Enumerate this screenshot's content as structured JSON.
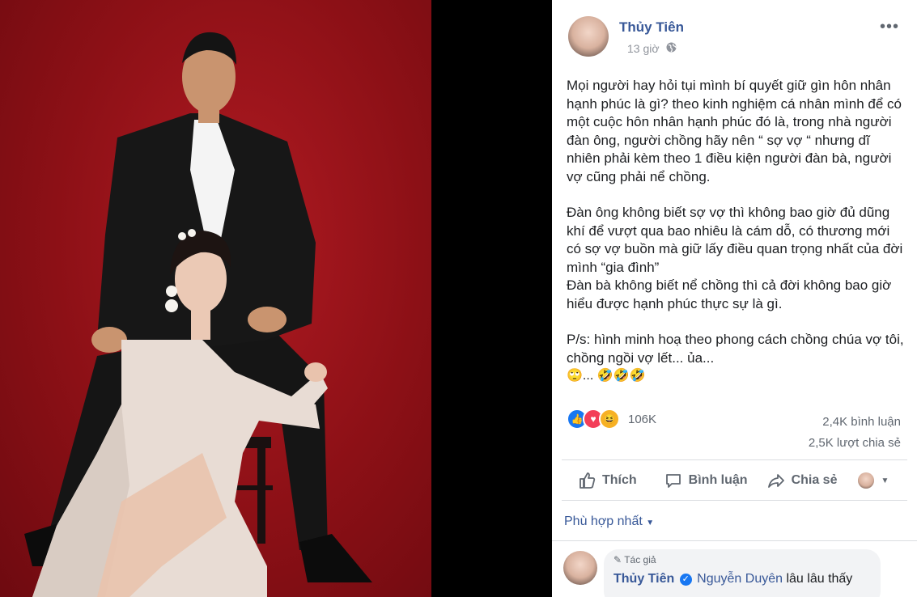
{
  "post": {
    "author": "Thủy Tiên",
    "time": "13 giờ",
    "more_label": "•••",
    "paragraphs": [
      "Mọi người hay hỏi tụi mình bí quyết giữ gìn hôn nhân hạnh phúc là gì? theo kinh nghiệm cá nhân mình để có một cuộc hôn nhân hạnh phúc đó là, trong nhà người đàn ông, người chồng hãy nên “ sợ vợ “ nhưng dĩ nhiên phải kèm theo 1 điều kiện người đàn bà, người vợ cũng phải nể chồng.",
      "Đàn ông không biết sợ vợ thì không bao giờ đủ dũng khí để vượt qua bao nhiêu là cám dỗ, có thương mới có sợ vợ buồn mà giữ lấy điều quan trọng nhất của đời mình “gia đình”",
      "Đàn bà không biết nể chồng thì cả đời không bao giờ hiểu được hạnh phúc thực sự là gì.",
      "P/s: hình minh hoạ theo phong cách chồng chúa vợ tôi, chồng ngồi vợ lết... ủa...",
      "🙄... 🤣🤣🤣"
    ],
    "reactions": {
      "icons": [
        "like-icon",
        "love-icon",
        "haha-icon"
      ],
      "count": "106K",
      "comments": "2,4K bình luận",
      "shares": "2,5K lượt chia sẻ"
    },
    "actions": {
      "like": "Thích",
      "comment": "Bình luận",
      "share": "Chia sẻ"
    },
    "sort_label": "Phù hợp nhất"
  },
  "comment": {
    "badge": "Tác giả",
    "author": "Thủy Tiên",
    "tag": "Nguyễn Duyên",
    "text": "lâu lâu thấy"
  },
  "colors": {
    "accent": "#385898",
    "photo_bg": "#8c1016",
    "secondary_text": "#606770"
  }
}
